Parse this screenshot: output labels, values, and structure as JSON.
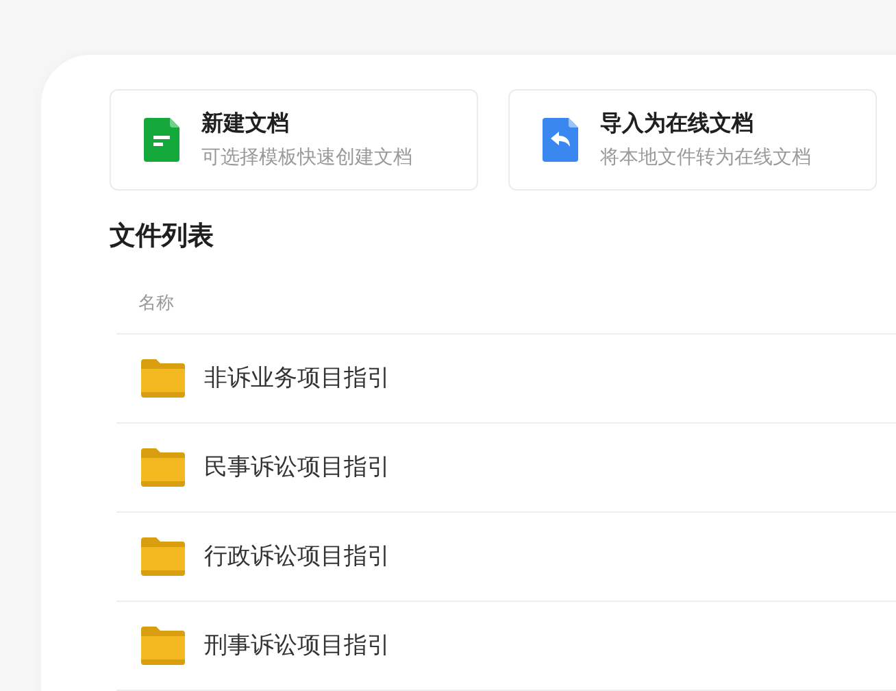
{
  "actions": [
    {
      "kind": "new",
      "title": "新建文档",
      "subtitle": "可选择模板快速创建文档"
    },
    {
      "kind": "import",
      "title": "导入为在线文档",
      "subtitle": "将本地文件转为在线文档"
    }
  ],
  "file_list": {
    "title": "文件列表",
    "columns": [
      "名称"
    ],
    "rows": [
      {
        "name": "非诉业务项目指引"
      },
      {
        "name": "民事诉讼项目指引"
      },
      {
        "name": "行政诉讼项目指引"
      },
      {
        "name": "刑事诉讼项目指引"
      }
    ]
  }
}
